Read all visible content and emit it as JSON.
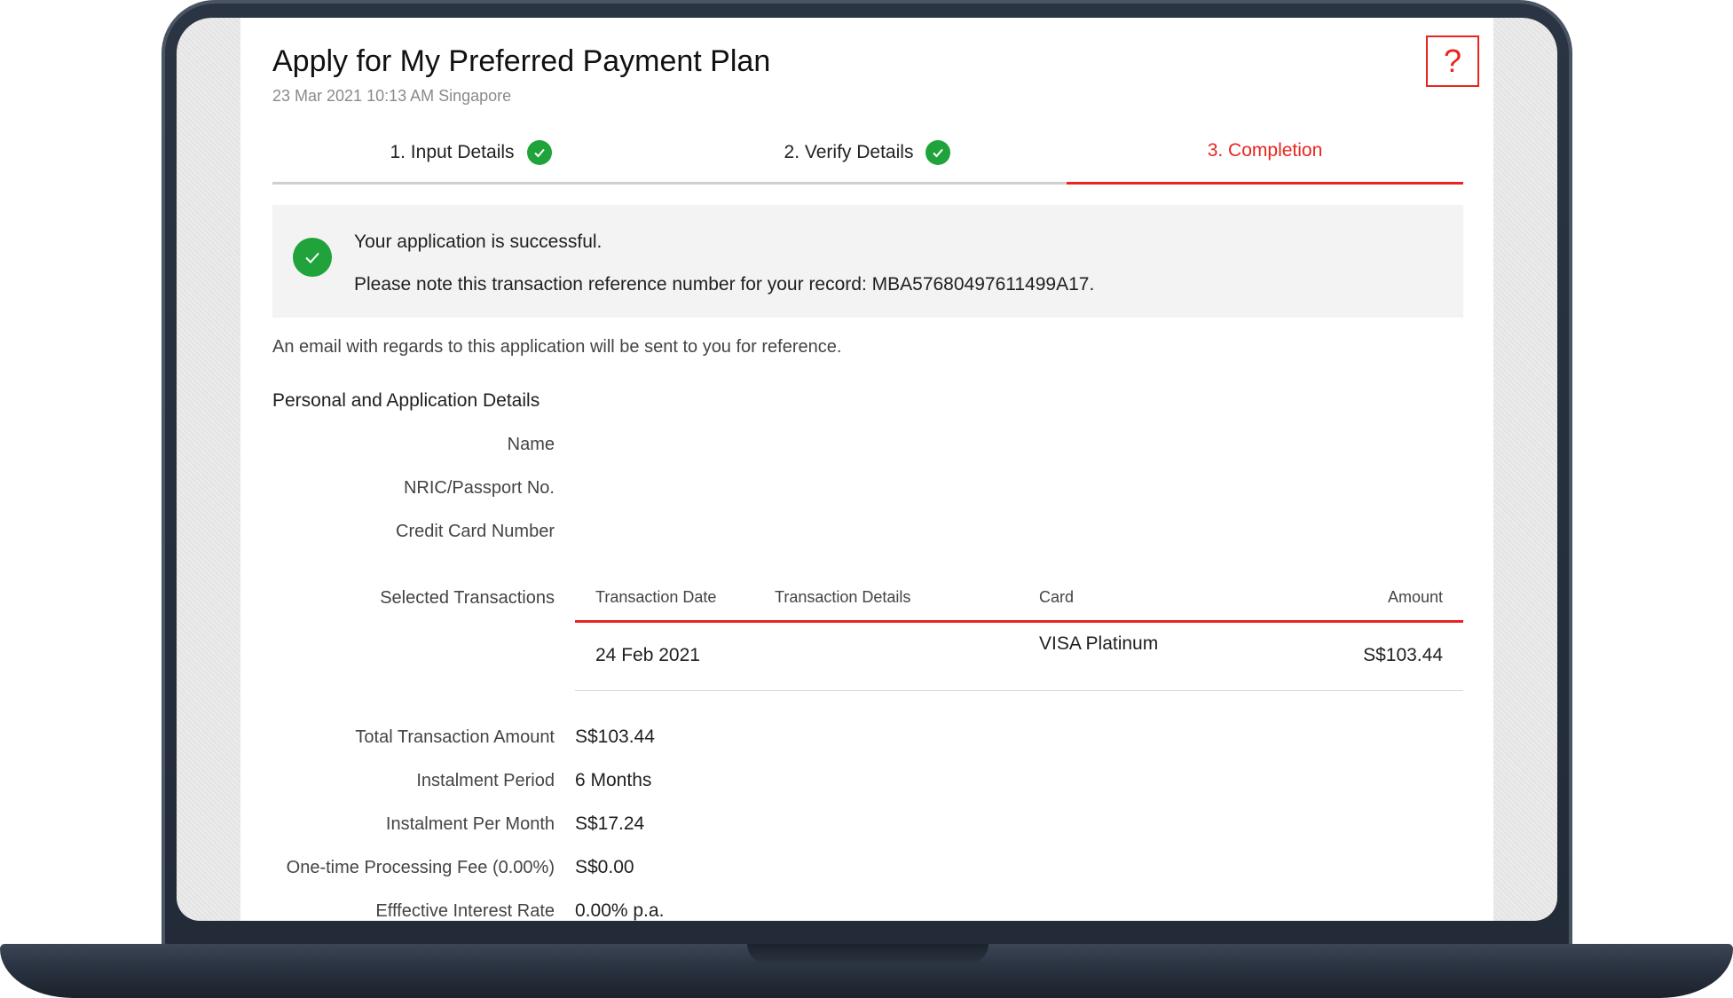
{
  "header": {
    "title": "Apply for My Preferred Payment Plan",
    "timestamp": "23 Mar 2021 10:13 AM Singapore",
    "help_label": "?"
  },
  "steps": [
    {
      "label": "1. Input Details",
      "status": "done"
    },
    {
      "label": "2. Verify Details",
      "status": "done"
    },
    {
      "label": "3. Completion",
      "status": "active"
    }
  ],
  "success": {
    "message": "Your application is successful.",
    "reference_note": "Please note this transaction reference number for your record: MBA57680497611499A17."
  },
  "email_note": "An email with regards to this application will be sent to you for reference.",
  "details": {
    "section_title": "Personal and Application Details",
    "name_label": "Name",
    "nric_label": "NRIC/Passport No.",
    "card_number_label": "Credit Card Number",
    "selected_transactions_label": "Selected Transactions"
  },
  "transactions": {
    "columns": [
      "Transaction Date",
      "Transaction Details",
      "Card",
      "Amount"
    ],
    "rows": [
      {
        "date": "24 Feb 2021",
        "details": "",
        "card": "VISA Platinum",
        "amount": "S$103.44"
      }
    ]
  },
  "summary": [
    {
      "label": "Total Transaction Amount",
      "value": "S$103.44"
    },
    {
      "label": "Instalment Period",
      "value": "6 Months"
    },
    {
      "label": "Instalment Per Month",
      "value": "S$17.24"
    },
    {
      "label": "One-time Processing Fee (0.00%)",
      "value": "S$0.00"
    },
    {
      "label": "Efffective Interest Rate",
      "value": "0.00% p.a."
    }
  ],
  "colors": {
    "accent": "#e8251f",
    "success": "#1fa33a",
    "bezel": "#222b37"
  },
  "icons": {
    "help": "question-mark-icon",
    "step_done": "check-circle-icon",
    "success": "check-circle-icon"
  }
}
